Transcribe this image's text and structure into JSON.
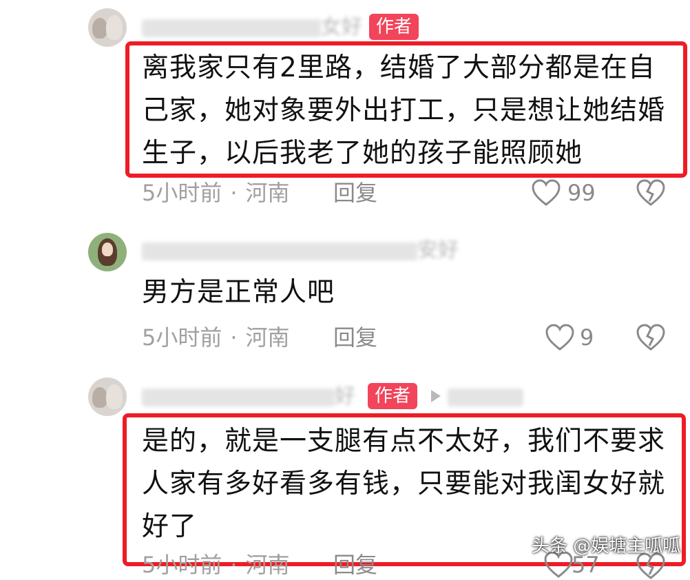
{
  "comments": [
    {
      "author_tag": "作者",
      "username_visible_tail": "女好",
      "text_lines": [
        "离我家只有2里路，结婚了大部分都是在自",
        "己家，她对象要外出打工，只是想让她结婚",
        "生子，以后我老了她的孩子能照顾她"
      ],
      "time": "5小时前",
      "separator": "·",
      "location": "河南",
      "reply_label": "回复",
      "like_count": "99"
    },
    {
      "username_visible_tail": "安好",
      "text_lines": [
        "男方是正常人吧"
      ],
      "time": "5小时前",
      "separator": "·",
      "location": "河南",
      "reply_label": "回复",
      "like_count": "9"
    },
    {
      "author_tag": "作者",
      "username_visible_tail": "好",
      "text_lines": [
        "是的，就是一支腿有点不太好，我们不要求",
        "人家有多好看多有钱，只要能对我闺女好就",
        "好了"
      ],
      "time": "5小时前",
      "separator": "·",
      "location": "河南",
      "reply_label": "回复",
      "like_count": "57"
    }
  ],
  "watermark": "头条 @娱塘主呱呱",
  "colors": {
    "highlight_border": "#ee1c25",
    "author_badge_bg": "#f2445a",
    "meta_text": "#a0a0a0"
  },
  "icons": [
    "heart-outline-icon",
    "broken-heart-icon",
    "play-icon"
  ]
}
